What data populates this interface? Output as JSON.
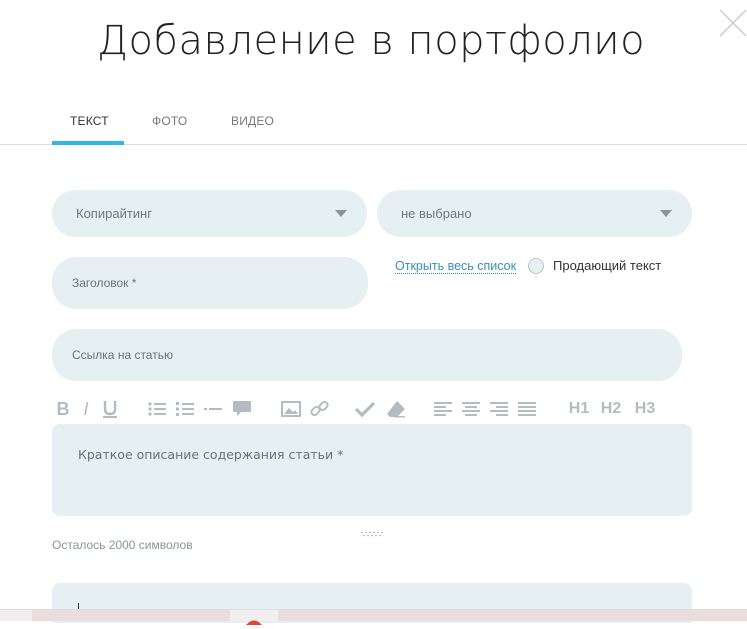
{
  "modal": {
    "title": "Добавление в портфолио"
  },
  "tabs": [
    {
      "label": "ТЕКСТ",
      "active": true
    },
    {
      "label": "ФОТО",
      "active": false
    },
    {
      "label": "ВИДЕО",
      "active": false
    }
  ],
  "form": {
    "category_select": {
      "value": "Копирайтинг"
    },
    "subcategory_select": {
      "value": "не выбрано"
    },
    "title_input": {
      "placeholder": "Заголовок *"
    },
    "open_list_link": "Открыть весь список",
    "selling_text": {
      "label": "Продающий текст",
      "checked": false
    },
    "article_link_input": {
      "placeholder": "Ссылка на статью"
    },
    "description": {
      "placeholder": "Краткое описание содержания статьи *"
    },
    "remaining_chars": "Осталось 2000 символов"
  },
  "toolbar": {
    "bold": "B",
    "italic": "I",
    "underline": "U",
    "h1": "H1",
    "h2": "H2",
    "h3": "H3",
    "icons": [
      "bold-icon",
      "italic-icon",
      "underline-icon",
      "bullet-list-icon",
      "numbered-list-icon",
      "horizontal-rule-icon",
      "quote-icon",
      "image-icon",
      "link-icon",
      "check-icon",
      "eraser-icon",
      "align-left-icon",
      "align-center-icon",
      "align-right-icon",
      "align-justify-icon"
    ]
  },
  "colors": {
    "accent": "#34b5e5",
    "field_bg": "#e6f0f3",
    "link": "#3a8fb7",
    "toolbar_icon": "#b4bcc1"
  }
}
